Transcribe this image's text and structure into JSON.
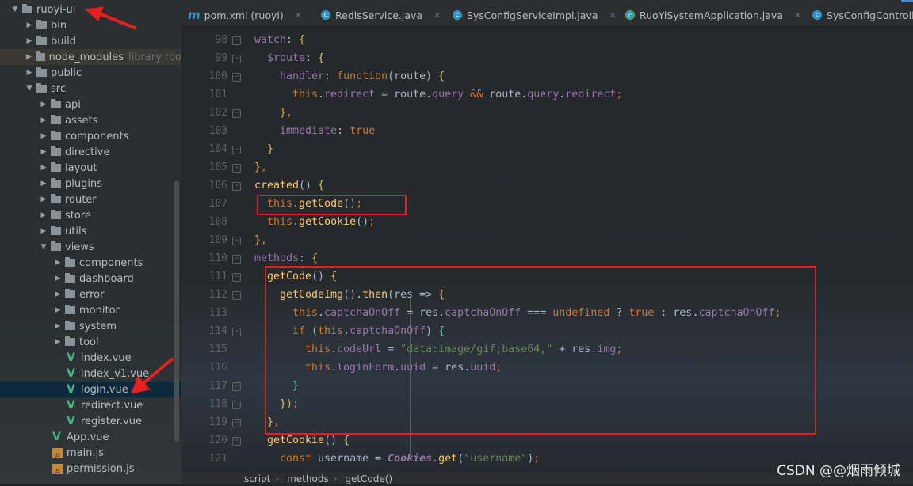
{
  "project_tree": [
    {
      "level": 0,
      "type": "folder",
      "expanded": true,
      "label": "ruoyi-ui"
    },
    {
      "level": 1,
      "type": "folder",
      "expanded": false,
      "label": "bin"
    },
    {
      "level": 1,
      "type": "folder",
      "expanded": false,
      "label": "build"
    },
    {
      "level": 1,
      "type": "folder",
      "expanded": false,
      "label": "node_modules",
      "suffix": "library roo",
      "highlighted": true
    },
    {
      "level": 1,
      "type": "folder",
      "expanded": false,
      "label": "public"
    },
    {
      "level": 1,
      "type": "folder",
      "expanded": true,
      "label": "src"
    },
    {
      "level": 2,
      "type": "folder",
      "expanded": false,
      "label": "api"
    },
    {
      "level": 2,
      "type": "folder",
      "expanded": false,
      "label": "assets"
    },
    {
      "level": 2,
      "type": "folder",
      "expanded": false,
      "label": "components"
    },
    {
      "level": 2,
      "type": "folder",
      "expanded": false,
      "label": "directive"
    },
    {
      "level": 2,
      "type": "folder",
      "expanded": false,
      "label": "layout"
    },
    {
      "level": 2,
      "type": "folder",
      "expanded": false,
      "label": "plugins"
    },
    {
      "level": 2,
      "type": "folder",
      "expanded": false,
      "label": "router"
    },
    {
      "level": 2,
      "type": "folder",
      "expanded": false,
      "label": "store"
    },
    {
      "level": 2,
      "type": "folder",
      "expanded": false,
      "label": "utils"
    },
    {
      "level": 2,
      "type": "folder",
      "expanded": true,
      "label": "views"
    },
    {
      "level": 3,
      "type": "folder",
      "expanded": false,
      "label": "components"
    },
    {
      "level": 3,
      "type": "folder",
      "expanded": false,
      "label": "dashboard"
    },
    {
      "level": 3,
      "type": "folder",
      "expanded": false,
      "label": "error"
    },
    {
      "level": 3,
      "type": "folder",
      "expanded": false,
      "label": "monitor"
    },
    {
      "level": 3,
      "type": "folder",
      "expanded": false,
      "label": "system"
    },
    {
      "level": 3,
      "type": "folder",
      "expanded": false,
      "label": "tool"
    },
    {
      "level": 3,
      "type": "vue",
      "label": "index.vue"
    },
    {
      "level": 3,
      "type": "vue",
      "label": "index_v1.vue"
    },
    {
      "level": 3,
      "type": "vue",
      "label": "login.vue",
      "selected": true
    },
    {
      "level": 3,
      "type": "vue",
      "label": "redirect.vue"
    },
    {
      "level": 3,
      "type": "vue",
      "label": "register.vue"
    },
    {
      "level": 2,
      "type": "vue",
      "label": "App.vue"
    },
    {
      "level": 2,
      "type": "js",
      "label": "main.js"
    },
    {
      "level": 2,
      "type": "js",
      "label": "permission.js"
    }
  ],
  "tabs": [
    {
      "icon": "maven-icon",
      "label": "pom.xml (ruoyi)"
    },
    {
      "icon": "class-icon",
      "label": "RedisService.java"
    },
    {
      "icon": "class-icon",
      "label": "SysConfigServiceImpl.java"
    },
    {
      "icon": "spring-boot-class-icon",
      "label": "RuoYiSystemApplication.java"
    },
    {
      "icon": "class-icon",
      "label": "SysConfigControlle"
    }
  ],
  "code_lines": [
    {
      "n": "98",
      "fold": "open",
      "indent": 0,
      "t": [
        [
          "p",
          "watch"
        ],
        [
          "",
          ": "
        ],
        [
          "y",
          "{"
        ]
      ]
    },
    {
      "n": "99",
      "fold": "open",
      "indent": 1,
      "t": [
        [
          "p",
          "$route"
        ],
        [
          "",
          ": "
        ],
        [
          "b",
          "{"
        ]
      ]
    },
    {
      "n": "100",
      "fold": "open",
      "indent": 2,
      "t": [
        [
          "p",
          "handler"
        ],
        [
          "",
          ": "
        ],
        [
          "k",
          "function"
        ],
        [
          "",
          "(route) "
        ],
        [
          "y",
          "{"
        ]
      ]
    },
    {
      "n": "101",
      "indent": 3,
      "t": [
        [
          "k",
          "this"
        ],
        [
          "",
          "."
        ],
        [
          "p",
          "redirect"
        ],
        [
          "",
          ""
        ],
        [
          "",
          " = route."
        ],
        [
          "p",
          "query"
        ],
        [
          "k",
          " && "
        ],
        [
          "",
          "route."
        ],
        [
          "p",
          "query"
        ],
        [
          "",
          "."
        ],
        [
          "p",
          "redirect"
        ],
        [
          "k",
          ";"
        ]
      ]
    },
    {
      "n": "102",
      "fold": "close",
      "indent": 2,
      "t": [
        [
          "y",
          "}"
        ],
        [
          "k",
          ","
        ]
      ]
    },
    {
      "n": "103",
      "indent": 2,
      "t": [
        [
          "p",
          "immediate"
        ],
        [
          "",
          ": "
        ],
        [
          "k",
          "true"
        ]
      ]
    },
    {
      "n": "104",
      "fold": "close",
      "indent": 1,
      "t": [
        [
          "b",
          "}"
        ]
      ]
    },
    {
      "n": "105",
      "fold": "close",
      "indent": 0,
      "t": [
        [
          "y",
          "}"
        ],
        [
          "k",
          ","
        ]
      ]
    },
    {
      "n": "106",
      "fold": "open",
      "indent": 0,
      "t": [
        [
          "f",
          "created"
        ],
        [
          "",
          "() "
        ],
        [
          "y",
          "{"
        ]
      ]
    },
    {
      "n": "107",
      "indent": 1,
      "t": [
        [
          "k",
          "this"
        ],
        [
          "",
          "."
        ],
        [
          "f",
          "getCode"
        ],
        [
          "",
          "()"
        ],
        [
          "k",
          ";"
        ]
      ]
    },
    {
      "n": "108",
      "indent": 1,
      "t": [
        [
          "k",
          "this"
        ],
        [
          "",
          "."
        ],
        [
          "f",
          "getCookie"
        ],
        [
          "",
          "()"
        ],
        [
          "k",
          ";"
        ]
      ]
    },
    {
      "n": "109",
      "fold": "close",
      "indent": 0,
      "t": [
        [
          "y",
          "}"
        ],
        [
          "k",
          ","
        ]
      ]
    },
    {
      "n": "110",
      "fold": "open",
      "indent": 0,
      "t": [
        [
          "p",
          "methods"
        ],
        [
          "",
          ": "
        ],
        [
          "y",
          "{"
        ]
      ]
    },
    {
      "n": "111",
      "fold": "open",
      "indent": 1,
      "t": [
        [
          "f",
          "getCode"
        ],
        [
          "",
          "() "
        ],
        [
          "b",
          "{"
        ]
      ]
    },
    {
      "n": "112",
      "fold": "open",
      "indent": 2,
      "t": [
        [
          "f",
          "getCodeImg"
        ],
        [
          "",
          "()."
        ],
        [
          "f",
          "then"
        ],
        [
          "",
          "(res => "
        ],
        [
          "b",
          "{"
        ]
      ]
    },
    {
      "n": "113",
      "indent": 3,
      "t": [
        [
          "k",
          "this"
        ],
        [
          "",
          "."
        ],
        [
          "p",
          "captchaOnOff"
        ],
        [
          "",
          ""
        ],
        [
          "",
          " = res."
        ],
        [
          "p",
          "captchaOnOff"
        ],
        [
          "",
          " === "
        ],
        [
          "k",
          "undefined"
        ],
        [
          "",
          " ? "
        ],
        [
          "k",
          "true"
        ],
        [
          "",
          " : res."
        ],
        [
          "p",
          "captchaOnOff"
        ],
        [
          "k",
          ";"
        ]
      ]
    },
    {
      "n": "114",
      "fold": "open",
      "indent": 3,
      "t": [
        [
          "k",
          "if "
        ],
        [
          "",
          "("
        ],
        [
          "k",
          "this"
        ],
        [
          "",
          "."
        ],
        [
          "p",
          "captchaOnOff"
        ],
        [
          "",
          ") "
        ],
        [
          "g",
          "{"
        ]
      ]
    },
    {
      "n": "115",
      "indent": 4,
      "t": [
        [
          "k",
          "this"
        ],
        [
          "",
          "."
        ],
        [
          "p",
          "codeUrl"
        ],
        [
          "",
          " = "
        ],
        [
          "s",
          "\"data:image/gif;base64,\""
        ],
        [
          "",
          " + res."
        ],
        [
          "p",
          "img"
        ],
        [
          "k",
          ";"
        ]
      ]
    },
    {
      "n": "116",
      "indent": 4,
      "t": [
        [
          "k",
          "this"
        ],
        [
          "",
          "."
        ],
        [
          "p",
          "loginForm"
        ],
        [
          "",
          "."
        ],
        [
          "p",
          "uuid"
        ],
        [
          "",
          " = res."
        ],
        [
          "p",
          "uuid"
        ],
        [
          "k",
          ";"
        ]
      ]
    },
    {
      "n": "117",
      "fold": "close",
      "indent": 3,
      "t": [
        [
          "g",
          "}"
        ]
      ]
    },
    {
      "n": "118",
      "fold": "close",
      "indent": 2,
      "t": [
        [
          "b",
          "}"
        ],
        [
          "y",
          ")"
        ],
        [
          "k",
          ";"
        ]
      ]
    },
    {
      "n": "119",
      "fold": "close",
      "indent": 1,
      "t": [
        [
          "b",
          "}"
        ],
        [
          "k",
          ","
        ]
      ]
    },
    {
      "n": "120",
      "fold": "open",
      "indent": 1,
      "t": [
        [
          "f",
          "getCookie"
        ],
        [
          "",
          "() "
        ],
        [
          "b",
          "{"
        ]
      ]
    },
    {
      "n": "121",
      "indent": 2,
      "t": [
        [
          "k",
          "const "
        ],
        [
          "",
          "username = "
        ],
        [
          "i",
          "Cookies"
        ],
        [
          "",
          "."
        ],
        [
          "f",
          "get"
        ],
        [
          "",
          "("
        ],
        [
          "s",
          "\"username\""
        ],
        [
          "",
          ")"
        ],
        [
          "k",
          ";"
        ]
      ]
    }
  ],
  "breadcrumb": [
    "script",
    "methods",
    "getCode()"
  ],
  "watermark": "CSDN @@烟雨倾城",
  "colors": {
    "annotation_red": "#e02020",
    "keyword": "#cc7832",
    "property": "#9876aa",
    "function": "#ffc66d",
    "string": "#6a8759",
    "selection": "#0d293e"
  }
}
